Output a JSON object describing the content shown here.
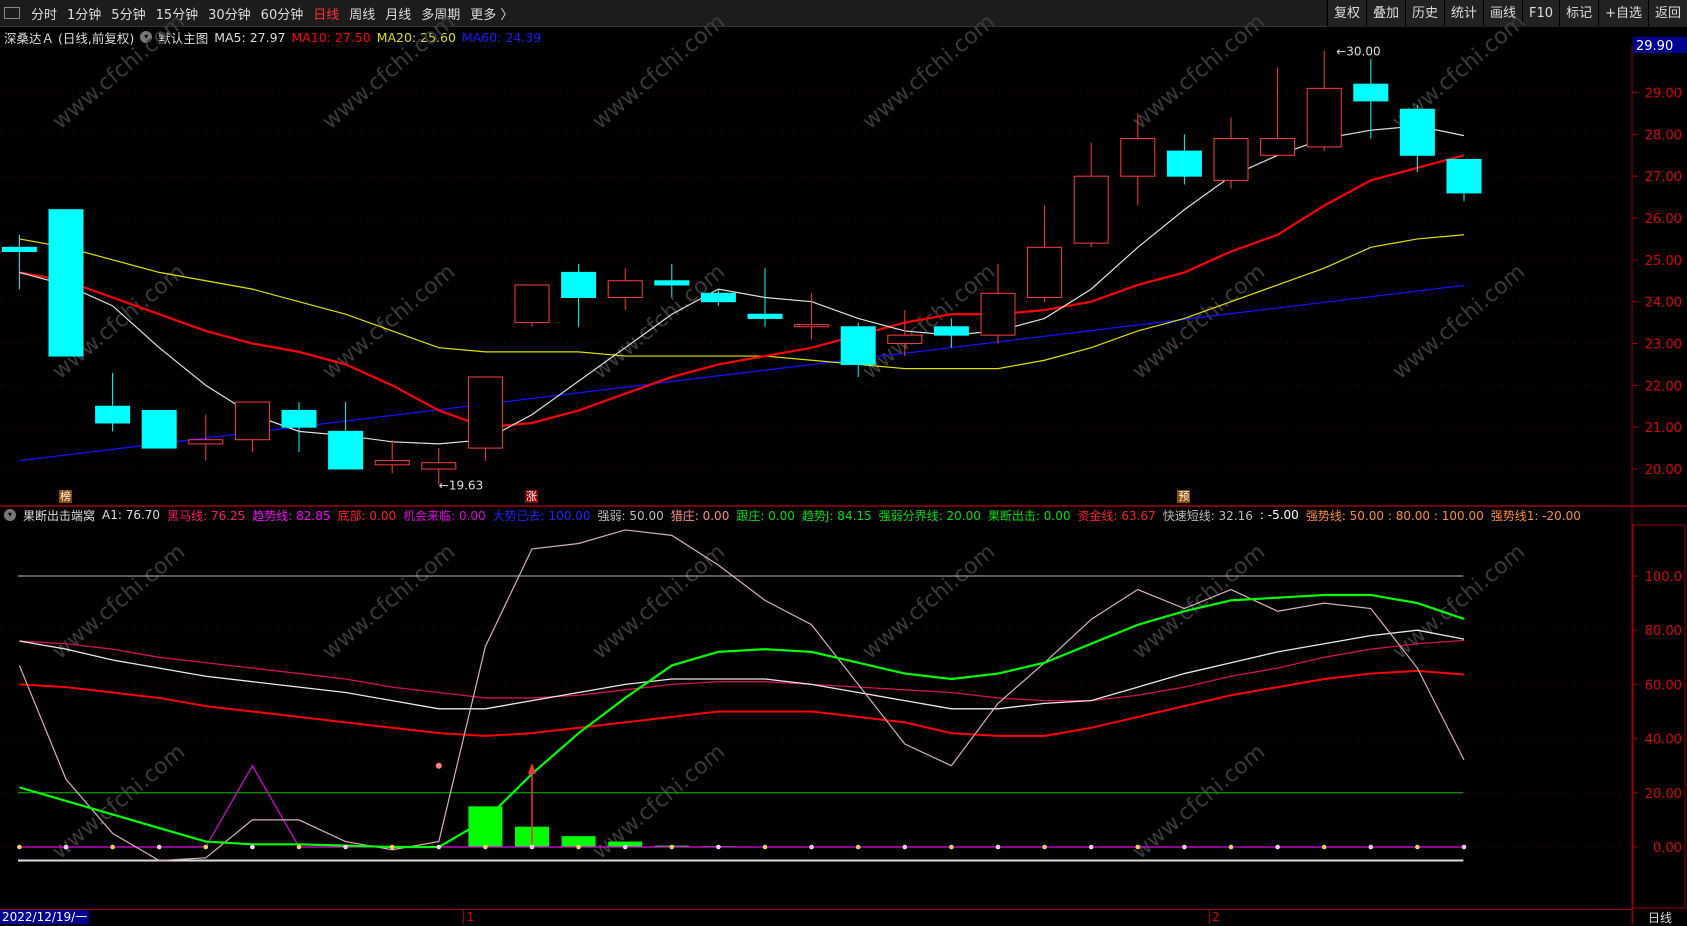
{
  "toolbar": {
    "periods": [
      "分时",
      "1分钟",
      "5分钟",
      "15分钟",
      "30分钟",
      "60分钟",
      "日线",
      "周线",
      "月线",
      "多周期",
      "更多 〉"
    ],
    "active": "日线",
    "buttons": [
      "复权",
      "叠加",
      "历史",
      "统计",
      "画线",
      "F10",
      "标记",
      "+自选",
      "返回"
    ]
  },
  "info": {
    "title": "深桑达Ａ (日线,前复权)",
    "main_chart": "默认主图",
    "ma5": "MA5: 27.97",
    "ma10": "MA10: 27.50",
    "ma20": "MA20: 25.60",
    "ma60": "MA60: 24.39"
  },
  "colors": {
    "up": "#ff3b3b",
    "down": "#00ffff",
    "ma5": "#e0e0e0",
    "ma10": "#ff0000",
    "ma20": "#e0e000",
    "ma60": "#1010ff"
  },
  "price_axis": {
    "labels": [
      "29.00",
      "28.00",
      "27.00",
      "26.00",
      "25.00",
      "24.00",
      "23.00",
      "22.00",
      "21.00",
      "20.00"
    ],
    "current": "29.90"
  },
  "ind_axis": {
    "labels": [
      "100.0",
      "80.00",
      "60.00",
      "40.00",
      "20.00",
      "0.00"
    ]
  },
  "annotations": {
    "high": "30.00",
    "low": "19.63"
  },
  "markers": [
    {
      "text": "榜",
      "idx": 1,
      "color": "#8a4a00"
    },
    {
      "text": "涨",
      "idx": 11,
      "color": "#8b0000"
    },
    {
      "text": "预",
      "idx": 25,
      "color": "#8a4a00"
    }
  ],
  "indicator_legend": [
    {
      "t": "果断出击端窝",
      "c": "#ddd"
    },
    {
      "t": "A1: 76.70",
      "c": "#ddd"
    },
    {
      "t": "黑马线: 76.25",
      "c": "#ff1a6a"
    },
    {
      "t": "趋势线: 82.85",
      "c": "#ff00ff"
    },
    {
      "t": "底部: 0.00",
      "c": "#ff2020"
    },
    {
      "t": "机会来临: 0.00",
      "c": "#e000e0"
    },
    {
      "t": "大势已去: 100.00",
      "c": "#2020ff"
    },
    {
      "t": "强弱: 50.00",
      "c": "#bbb"
    },
    {
      "t": "猎庄: 0.00",
      "c": "#ff8a8a"
    },
    {
      "t": "跟庄: 0.00",
      "c": "#00e000"
    },
    {
      "t": "趋势J: 84.15",
      "c": "#00e000"
    },
    {
      "t": "强弱分界线: 20.00",
      "c": "#00e000"
    },
    {
      "t": "果断出击: 0.00",
      "c": "#00e000"
    },
    {
      "t": "资金线: 63.67",
      "c": "#ff2020"
    },
    {
      "t": "快速短线: 32.16",
      "c": "#bbb"
    },
    {
      "t": ": -5.00",
      "c": "#fff"
    },
    {
      "t": "强势线: 50.00 : 80.00 : 100.00",
      "c": "#ff8c30"
    },
    {
      "t": "强势线1: -20.00",
      "c": "#ff8c30"
    }
  ],
  "datebar": {
    "start": "2022/12/19/一",
    "months": [
      {
        "t": "1",
        "idx": 10
      },
      {
        "t": "2",
        "idx": 26
      }
    ],
    "period": "日线"
  },
  "watermark": "www.cfchi.com",
  "chart_data": {
    "type": "candlestick",
    "ohlc": [
      [
        25.3,
        25.6,
        24.3,
        25.2
      ],
      [
        26.2,
        26.2,
        22.7,
        22.7
      ],
      [
        21.5,
        22.3,
        20.9,
        21.1
      ],
      [
        21.4,
        21.4,
        20.5,
        20.5
      ],
      [
        20.6,
        21.3,
        20.2,
        20.7
      ],
      [
        20.7,
        21.6,
        20.4,
        21.6
      ],
      [
        21.4,
        21.6,
        20.4,
        21.0
      ],
      [
        20.9,
        21.6,
        20.0,
        20.0
      ],
      [
        20.1,
        20.7,
        19.9,
        20.2
      ],
      [
        20.0,
        20.5,
        19.63,
        20.15
      ],
      [
        20.5,
        22.2,
        20.2,
        22.2
      ],
      [
        23.5,
        24.4,
        23.4,
        24.4
      ],
      [
        24.7,
        24.9,
        23.4,
        24.1
      ],
      [
        24.1,
        24.8,
        23.8,
        24.5
      ],
      [
        24.5,
        24.9,
        24.1,
        24.4
      ],
      [
        24.2,
        24.3,
        23.9,
        24.0
      ],
      [
        23.7,
        24.8,
        23.4,
        23.6
      ],
      [
        23.4,
        24.2,
        23.1,
        23.45
      ],
      [
        23.4,
        23.5,
        22.2,
        22.5
      ],
      [
        23.0,
        23.8,
        22.7,
        23.2
      ],
      [
        23.4,
        23.6,
        22.9,
        23.2
      ],
      [
        23.2,
        24.9,
        23.0,
        24.2
      ],
      [
        24.1,
        26.3,
        24.0,
        25.3
      ],
      [
        25.4,
        27.8,
        25.3,
        27.0
      ],
      [
        27.0,
        28.5,
        26.3,
        27.9
      ],
      [
        27.6,
        28.0,
        26.8,
        27.0
      ],
      [
        26.9,
        28.4,
        26.7,
        27.9
      ],
      [
        27.5,
        29.6,
        27.5,
        27.9
      ],
      [
        27.7,
        30.0,
        27.6,
        29.1
      ],
      [
        29.2,
        29.8,
        27.9,
        28.8
      ],
      [
        28.6,
        28.7,
        27.1,
        27.5
      ],
      [
        27.4,
        27.4,
        26.4,
        26.6
      ]
    ],
    "ma5": [
      24.7,
      24.4,
      23.9,
      22.9,
      22.0,
      21.3,
      20.9,
      20.8,
      20.65,
      20.6,
      20.7,
      21.3,
      22.1,
      22.9,
      23.7,
      24.3,
      24.1,
      24.0,
      23.6,
      23.3,
      23.2,
      23.3,
      23.6,
      24.3,
      25.3,
      26.2,
      27.0,
      27.5,
      27.9,
      28.1,
      28.2,
      27.97
    ],
    "ma10": [
      24.7,
      24.5,
      24.1,
      23.7,
      23.3,
      23.0,
      22.8,
      22.5,
      22.0,
      21.4,
      21.0,
      21.1,
      21.4,
      21.8,
      22.2,
      22.5,
      22.7,
      22.9,
      23.2,
      23.5,
      23.7,
      23.7,
      23.8,
      24.0,
      24.4,
      24.7,
      25.2,
      25.6,
      26.3,
      26.9,
      27.2,
      27.5
    ],
    "ma20": [
      25.5,
      25.3,
      25.0,
      24.7,
      24.5,
      24.3,
      24.0,
      23.7,
      23.3,
      22.9,
      22.8,
      22.8,
      22.8,
      22.7,
      22.7,
      22.7,
      22.7,
      22.6,
      22.5,
      22.4,
      22.4,
      22.4,
      22.6,
      22.9,
      23.3,
      23.6,
      24.0,
      24.4,
      24.8,
      25.3,
      25.5,
      25.6
    ],
    "ma60": [
      20.2,
      24.39
    ],
    "price_range": [
      19.2,
      30.3
    ],
    "indicator": {
      "range": [
        -10,
        120
      ],
      "趋势线J": [
        22,
        17,
        12,
        7,
        2,
        1,
        1,
        0.5,
        0,
        0,
        10,
        27,
        42,
        55,
        67,
        72,
        73,
        72,
        68,
        64,
        62,
        64,
        68,
        75,
        82,
        87,
        91,
        92,
        93,
        93,
        90,
        84.15
      ],
      "快速短线": [
        67,
        25,
        5,
        -5,
        -4,
        10,
        10,
        2,
        -1,
        2,
        74,
        110,
        112,
        117,
        115,
        104,
        91,
        82,
        60,
        38,
        30,
        53,
        68,
        84,
        95,
        88,
        95,
        87,
        90,
        88,
        66,
        32.16
      ],
      "趋势线": [
        0,
        0,
        0,
        0,
        0,
        30,
        0,
        0,
        0,
        0,
        0,
        0,
        0,
        0,
        0,
        0,
        0,
        0,
        0,
        0,
        0,
        0,
        0,
        0,
        0,
        0,
        0,
        0,
        0,
        0,
        0,
        0
      ],
      "黑马线": [
        76,
        75,
        73,
        70,
        68,
        66,
        64,
        62,
        59,
        57,
        55,
        55,
        56,
        58,
        60,
        61,
        61,
        60,
        59,
        58,
        57,
        55,
        54,
        54,
        56,
        59,
        63,
        66,
        70,
        73,
        75,
        76.25
      ],
      "A1": [
        76,
        73,
        69,
        66,
        63,
        61,
        59,
        57,
        54,
        51,
        51,
        54,
        57,
        60,
        62,
        62,
        62,
        60,
        57,
        54,
        51,
        51,
        53,
        54,
        59,
        64,
        68,
        72,
        75,
        78,
        80,
        76.7
      ],
      "资金线": [
        60,
        59,
        57,
        55,
        52,
        50,
        48,
        46,
        44,
        42,
        41,
        42,
        44,
        46,
        48,
        50,
        50,
        50,
        48,
        46,
        42,
        41,
        41,
        44,
        48,
        52,
        56,
        59,
        62,
        64,
        65,
        63.67
      ],
      "bars": [
        0,
        0,
        0,
        0,
        0,
        0,
        0,
        0,
        0,
        0,
        15,
        7.5,
        4,
        2,
        0.5,
        0.3,
        0,
        0,
        0,
        0,
        0,
        0,
        0,
        0,
        0,
        0,
        0,
        0,
        0,
        0,
        0,
        0
      ],
      "hlines": [
        100,
        20,
        -5
      ]
    }
  }
}
